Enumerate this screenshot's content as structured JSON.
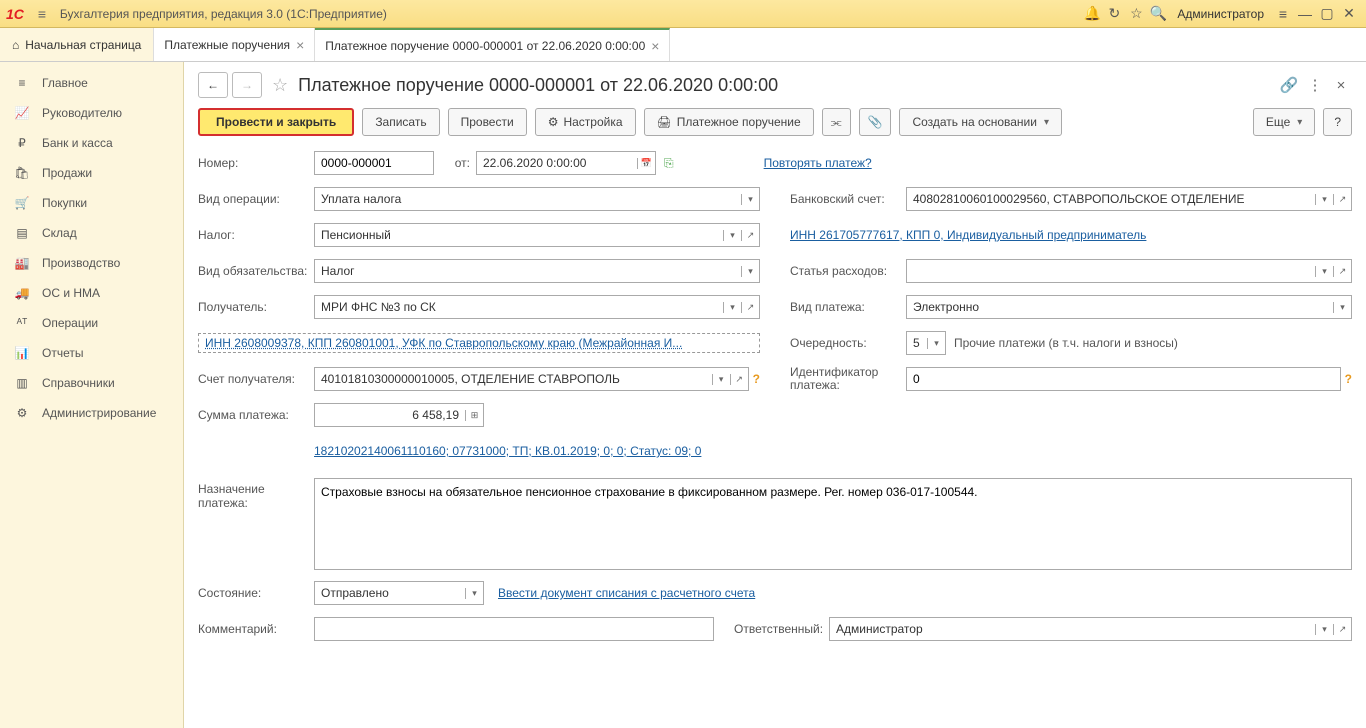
{
  "titlebar": {
    "app_title": "Бухгалтерия предприятия, редакция 3.0  (1С:Предприятие)",
    "user": "Администратор"
  },
  "tabs": {
    "home": "Начальная страница",
    "t1": "Платежные поручения",
    "t2": "Платежное поручение 0000-000001 от 22.06.2020 0:00:00"
  },
  "sidebar": [
    {
      "icon": "≡",
      "label": "Главное"
    },
    {
      "icon": "📈",
      "label": "Руководителю"
    },
    {
      "icon": "₽",
      "label": "Банк и касса"
    },
    {
      "icon": "🛍",
      "label": "Продажи"
    },
    {
      "icon": "🛒",
      "label": "Покупки"
    },
    {
      "icon": "▤",
      "label": "Склад"
    },
    {
      "icon": "🏭",
      "label": "Производство"
    },
    {
      "icon": "🚚",
      "label": "ОС и НМА"
    },
    {
      "icon": "ᴬᵀ",
      "label": "Операции"
    },
    {
      "icon": "📊",
      "label": "Отчеты"
    },
    {
      "icon": "▥",
      "label": "Справочники"
    },
    {
      "icon": "⚙",
      "label": "Администрирование"
    }
  ],
  "doc": {
    "title": "Платежное поручение 0000-000001 от 22.06.2020 0:00:00",
    "toolbar": {
      "post_close": "Провести и закрыть",
      "save": "Записать",
      "post": "Провести",
      "settings": "Настройка",
      "print": "Платежное поручение",
      "create_based": "Создать на основании",
      "more": "Еще"
    },
    "labels": {
      "number": "Номер:",
      "from": "от:",
      "repeat": "Повторять платеж?",
      "op_type": "Вид операции:",
      "bank_acc": "Банковский счет:",
      "tax": "Налог:",
      "inn_link": "ИНН 261705777617, КПП 0, Индивидуальный предприниматель",
      "obligation": "Вид обязательства:",
      "expense": "Статья расходов:",
      "recipient": "Получатель:",
      "pay_type": "Вид платежа:",
      "recip_inn": "ИНН 2608009378, КПП 260801001, УФК по Ставропольскому краю (Межрайонная И...",
      "priority": "Очередность:",
      "priority_text": "Прочие платежи (в т.ч. налоги и взносы)",
      "recip_acc": "Счет получателя:",
      "pay_id": "Идентификатор платежа:",
      "amount": "Сумма платежа:",
      "kbk_link": "18210202140061110160; 07731000; ТП; КВ.01.2019; 0; 0; Статус: 09; 0",
      "purpose": "Назначение платежа:",
      "state": "Состояние:",
      "enter_doc": "Ввести документ списания с расчетного счета",
      "comment": "Комментарий:",
      "responsible": "Ответственный:"
    },
    "values": {
      "number": "0000-000001",
      "date": "22.06.2020  0:00:00",
      "op_type": "Уплата налога",
      "bank_acc": "40802810060100029560, СТАВРОПОЛЬСКОЕ ОТДЕЛЕНИЕ",
      "tax": "Пенсионный",
      "obligation": "Налог",
      "recipient": "МРИ ФНС №3 по СК",
      "pay_type": "Электронно",
      "priority": "5",
      "recip_acc": "40101810300000010005, ОТДЕЛЕНИЕ СТАВРОПОЛЬ",
      "pay_id": "0",
      "amount": "6 458,19",
      "purpose": "Страховые взносы на обязательное пенсионное страхование в фиксированном размере. Рег. номер 036-017-100544.",
      "state": "Отправлено",
      "comment": "",
      "responsible": "Администратор"
    }
  }
}
